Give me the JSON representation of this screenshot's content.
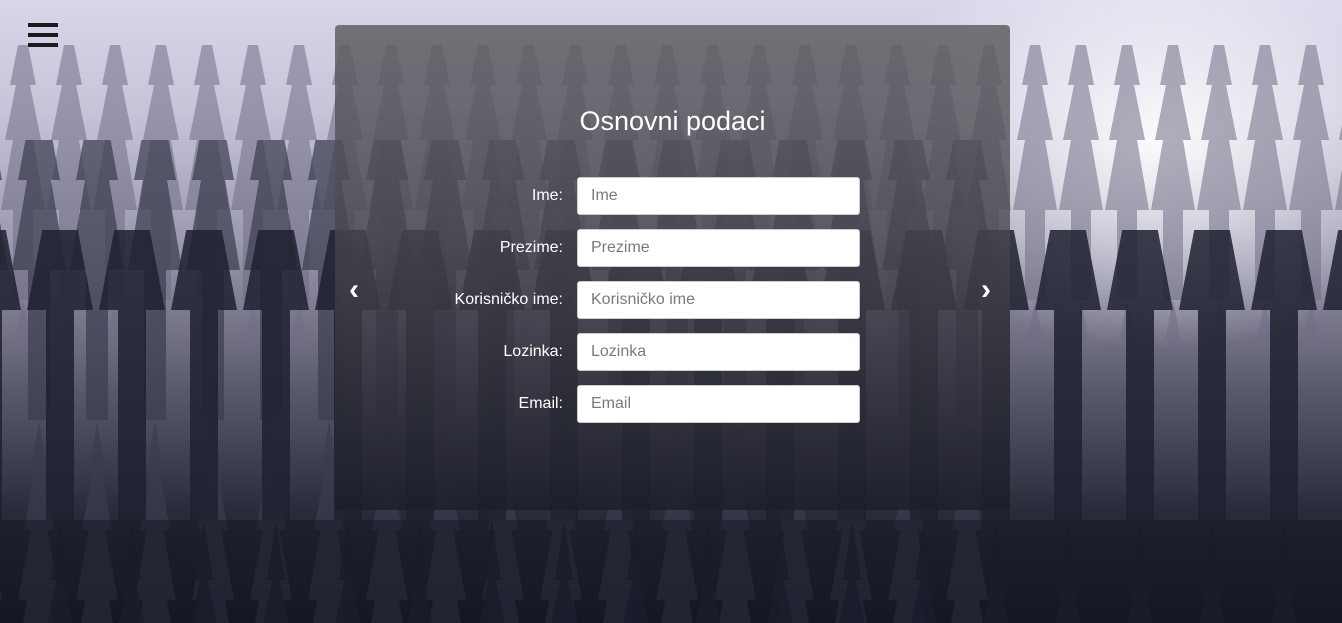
{
  "menu": {
    "icon": "hamburger-menu-icon"
  },
  "form": {
    "title": "Osnovni podaci",
    "prev_arrow": "‹",
    "next_arrow": "›",
    "fields": [
      {
        "label": "Ime:",
        "placeholder": "Ime",
        "value": ""
      },
      {
        "label": "Prezime:",
        "placeholder": "Prezime",
        "value": ""
      },
      {
        "label": "Korisničko ime:",
        "placeholder": "Korisničko ime",
        "value": ""
      },
      {
        "label": "Lozinka:",
        "placeholder": "Lozinka",
        "value": ""
      },
      {
        "label": "Email:",
        "placeholder": "Email",
        "value": ""
      }
    ]
  },
  "colors": {
    "panel": "#505058",
    "text": "#ffffff",
    "input_background": "#ffffff",
    "input_border": "#cccccc"
  }
}
